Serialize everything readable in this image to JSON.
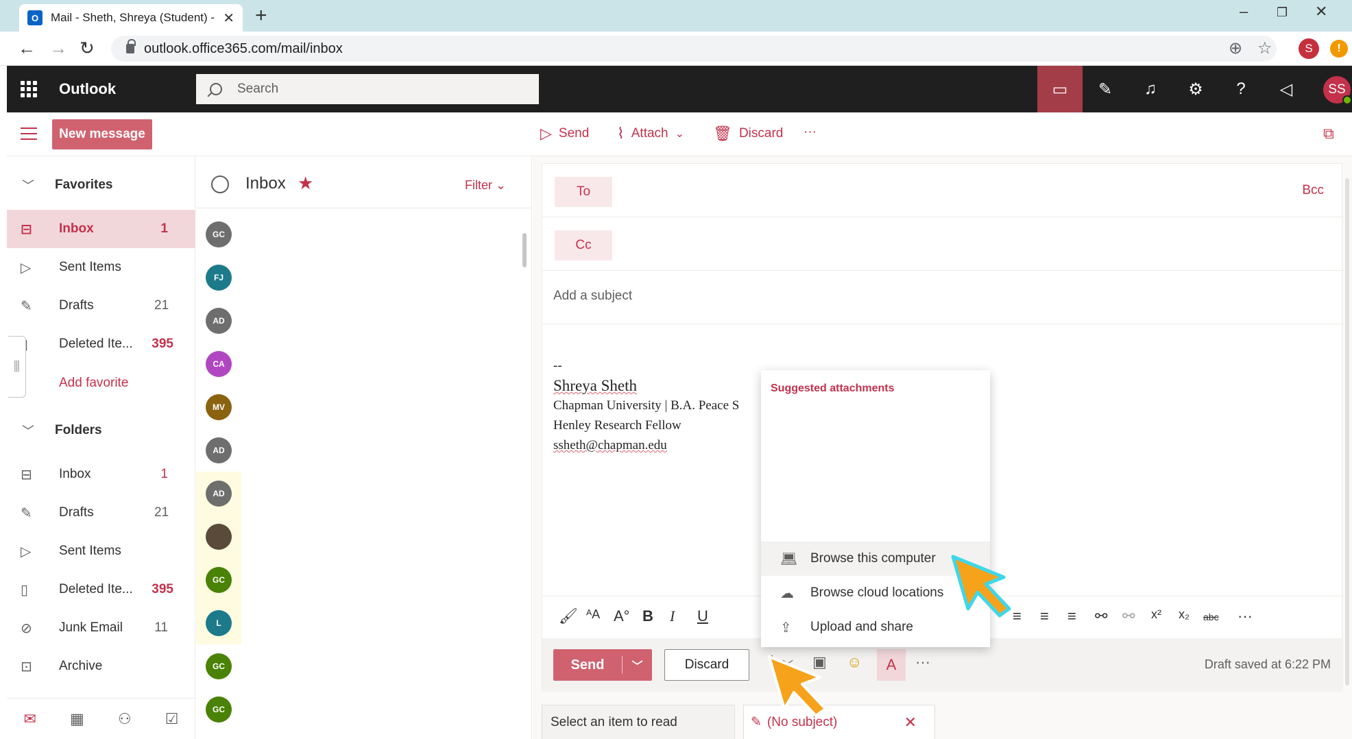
{
  "browser": {
    "tab_title": "Mail - Sheth, Shreya (Student) - C",
    "favicon_letter": "O",
    "url": "outlook.office365.com/mail/inbox",
    "profile_initial": "S",
    "update_badge": "!"
  },
  "app": {
    "brand": "Outlook",
    "search_placeholder": "Search",
    "user_initials": "SS"
  },
  "commands": {
    "new_message": "New message",
    "send": "Send",
    "attach": "Attach",
    "discard": "Discard",
    "more": "···"
  },
  "leftnav": {
    "favorites_label": "Favorites",
    "favorites": [
      {
        "label": "Inbox",
        "count": "1",
        "selected": true
      },
      {
        "label": "Sent Items",
        "count": ""
      },
      {
        "label": "Drafts",
        "count": "21"
      },
      {
        "label": "Deleted Ite...",
        "count": "395"
      }
    ],
    "add_favorite": "Add favorite",
    "folders_label": "Folders",
    "folders": [
      {
        "label": "Inbox",
        "count": "1"
      },
      {
        "label": "Drafts",
        "count": "21"
      },
      {
        "label": "Sent Items",
        "count": ""
      },
      {
        "label": "Deleted Ite...",
        "count": "395"
      },
      {
        "label": "Junk Email",
        "count": "11"
      },
      {
        "label": "Archive",
        "count": ""
      }
    ]
  },
  "message_list": {
    "title": "Inbox",
    "filter": "Filter",
    "avatars": [
      {
        "initials": "GC",
        "color": "#6e6e6e"
      },
      {
        "initials": "FJ",
        "color": "#1c7a8a"
      },
      {
        "initials": "AD",
        "color": "#6e6e6e"
      },
      {
        "initials": "CA",
        "color": "#b146c2"
      },
      {
        "initials": "MV",
        "color": "#8a6210"
      },
      {
        "initials": "AD",
        "color": "#6e6e6e"
      },
      {
        "initials": "AD",
        "color": "#6e6e6e"
      },
      {
        "initials": "",
        "color": "#5a4a3a"
      },
      {
        "initials": "GC",
        "color": "#498205"
      },
      {
        "initials": "L",
        "color": "#1c7a8a"
      },
      {
        "initials": "GC",
        "color": "#498205"
      },
      {
        "initials": "GC",
        "color": "#498205"
      }
    ]
  },
  "compose": {
    "to_label": "To",
    "cc_label": "Cc",
    "bcc_label": "Bcc",
    "subject_placeholder": "Add a subject",
    "signature": {
      "dashes": "--",
      "name": "Shreya Sheth",
      "line1": "Chapman University | B.A. Peace S",
      "line2": "Henley Research Fellow",
      "email": "ssheth@chapman.edu"
    },
    "send_label": "Send",
    "discard_label": "Discard",
    "draft_status": "Draft saved at 6:22 PM"
  },
  "attach_dropdown": {
    "header": "Suggested attachments",
    "items": [
      {
        "label": "Browse this computer",
        "icon": "laptop-icon"
      },
      {
        "label": "Browse cloud locations",
        "icon": "cloud-icon"
      },
      {
        "label": "Upload and share",
        "icon": "cloud-upload-icon"
      }
    ]
  },
  "bottom_tabs": {
    "reading_pane": "Select an item to read",
    "draft_tab": "(No subject)"
  },
  "colors": {
    "accent": "#c4314b",
    "accent_button": "#d06270",
    "topbar": "#1f1f1f",
    "cursor": "#f7a21b",
    "cursor_outline": "#3fd7e8"
  }
}
